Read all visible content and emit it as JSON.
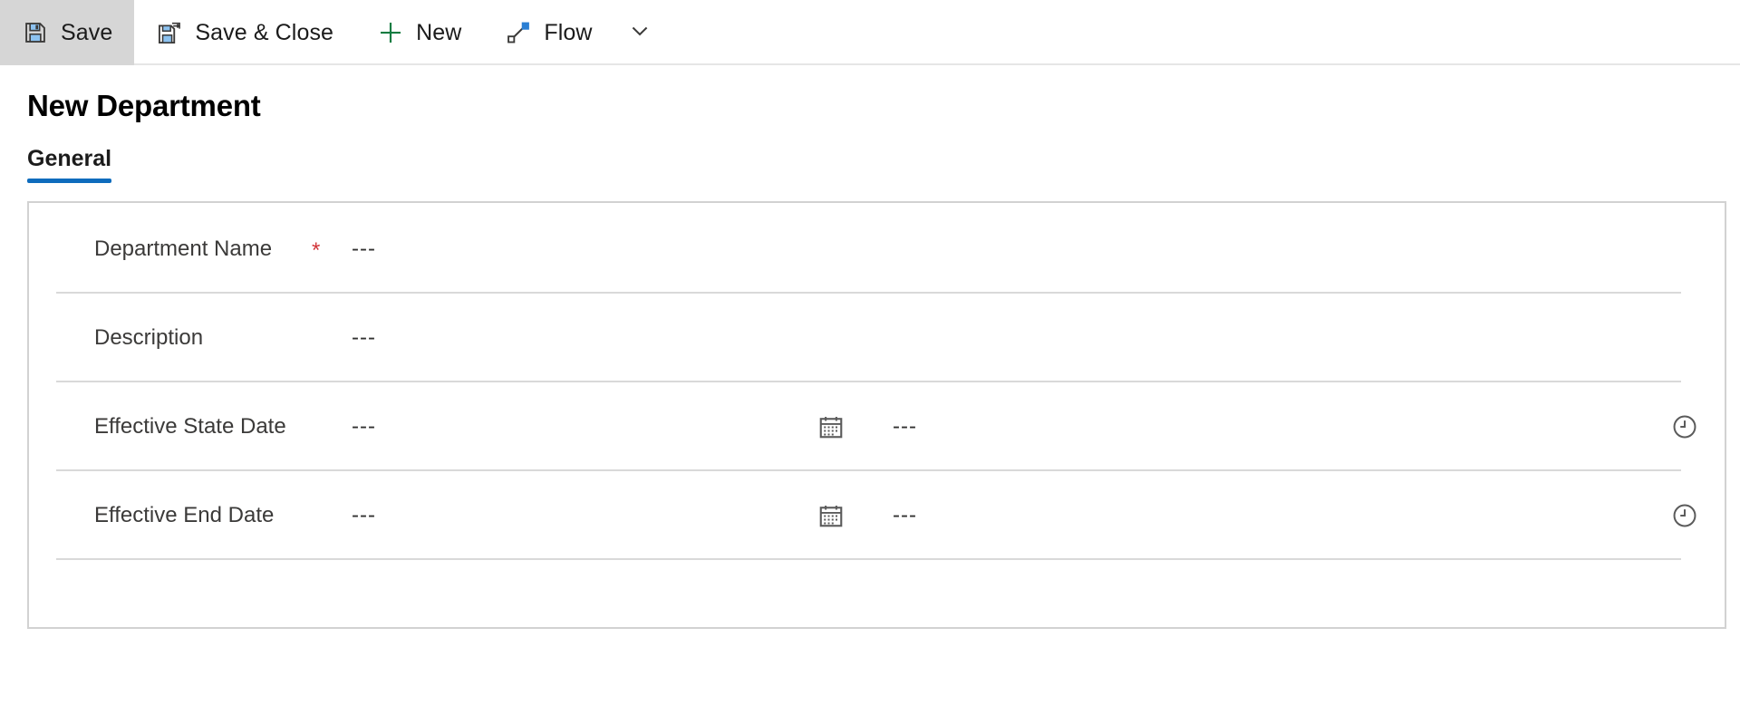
{
  "theme": {
    "accent": "#0f6cbd",
    "required_color": "#d13438",
    "toolbar_active_bg": "#d6d6d6",
    "card_border": "#d2d2d2",
    "row_divider": "#d9d9d9",
    "label_color": "#3b3a39"
  },
  "commandbar": {
    "buttons": [
      {
        "label": "Save",
        "icon": "save-icon",
        "active": true
      },
      {
        "label": "Save & Close",
        "icon": "save-close-icon",
        "active": false
      },
      {
        "label": "New",
        "icon": "plus-icon",
        "active": false
      },
      {
        "label": "Flow",
        "icon": "flow-icon",
        "active": false
      }
    ],
    "overflow_icon": "chevron-down-icon"
  },
  "page": {
    "title": "New Department"
  },
  "tabs": [
    {
      "label": "General",
      "selected": true
    }
  ],
  "form": {
    "rows": [
      {
        "label": "Department Name",
        "required": true,
        "required_mark": "*",
        "value": "---",
        "type": "text"
      },
      {
        "label": "Description",
        "required": false,
        "required_mark": "",
        "value": "---",
        "type": "text"
      },
      {
        "label": "Effective State Date",
        "required": false,
        "required_mark": "",
        "value": "---",
        "time_value": "---",
        "type": "datetime",
        "date_icon": "calendar-icon",
        "time_icon": "clock-icon"
      },
      {
        "label": "Effective End Date",
        "required": false,
        "required_mark": "",
        "value": "---",
        "time_value": "---",
        "type": "datetime",
        "date_icon": "calendar-icon",
        "time_icon": "clock-icon"
      }
    ]
  }
}
